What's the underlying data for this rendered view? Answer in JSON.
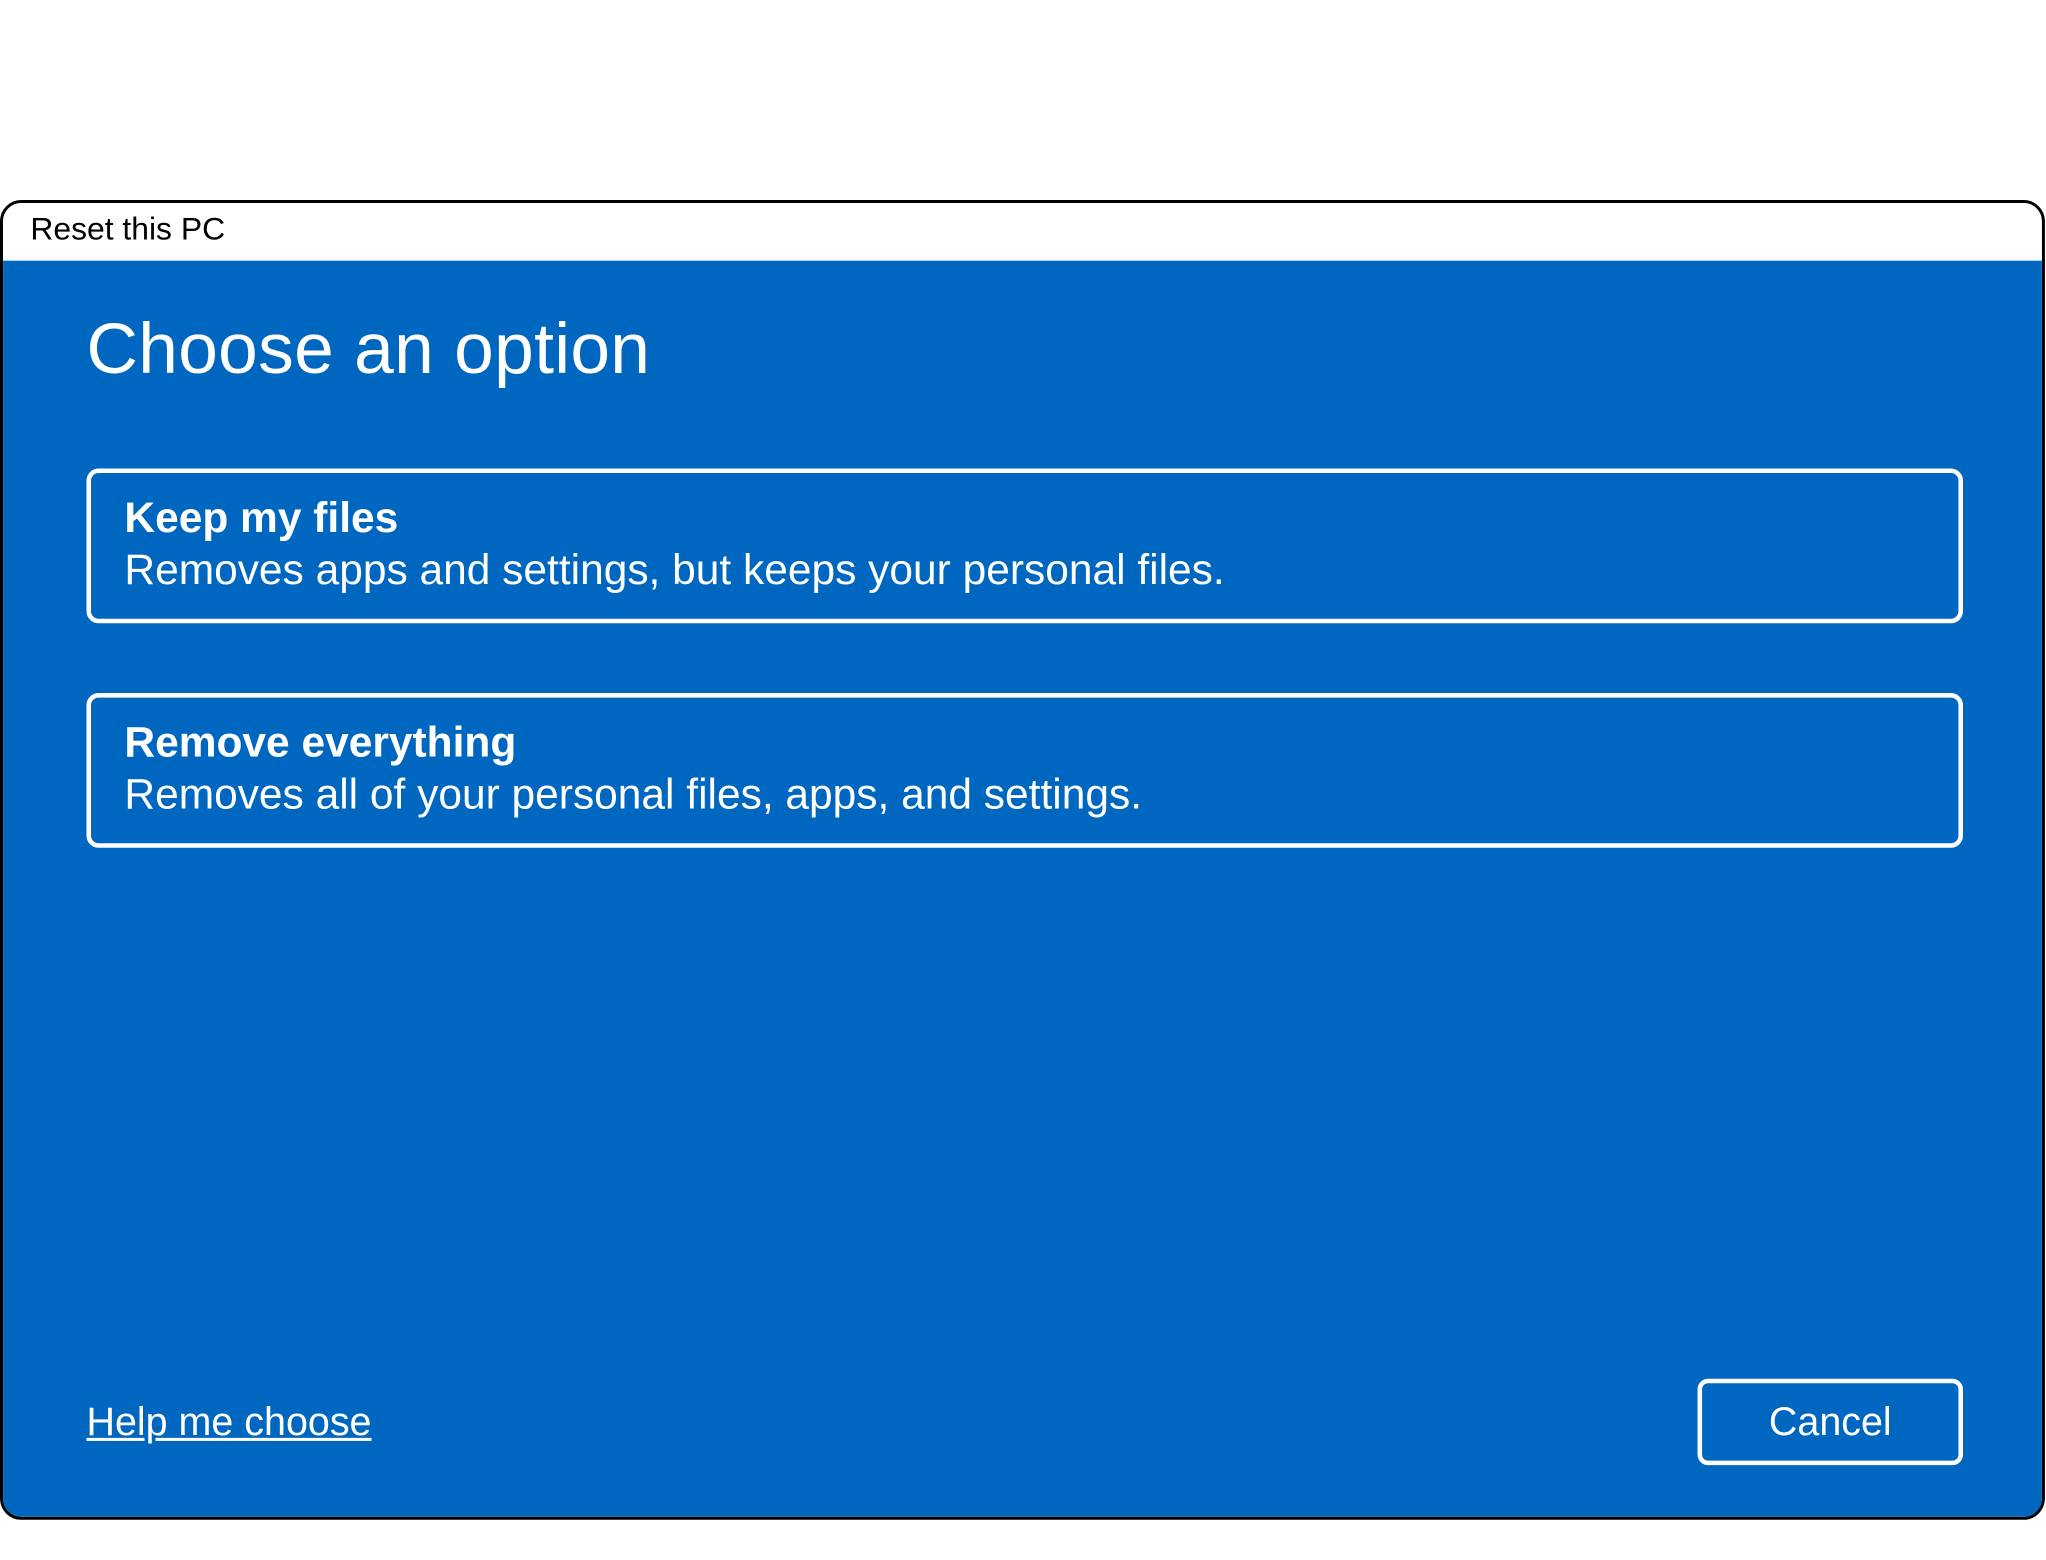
{
  "window": {
    "title": "Reset this PC"
  },
  "main": {
    "heading": "Choose an option",
    "options": [
      {
        "title": "Keep my files",
        "description": "Removes apps and settings, but keeps your personal files."
      },
      {
        "title": "Remove everything",
        "description": "Removes all of your personal files, apps, and settings."
      }
    ]
  },
  "footer": {
    "help_label": "Help me choose",
    "cancel_label": "Cancel"
  }
}
